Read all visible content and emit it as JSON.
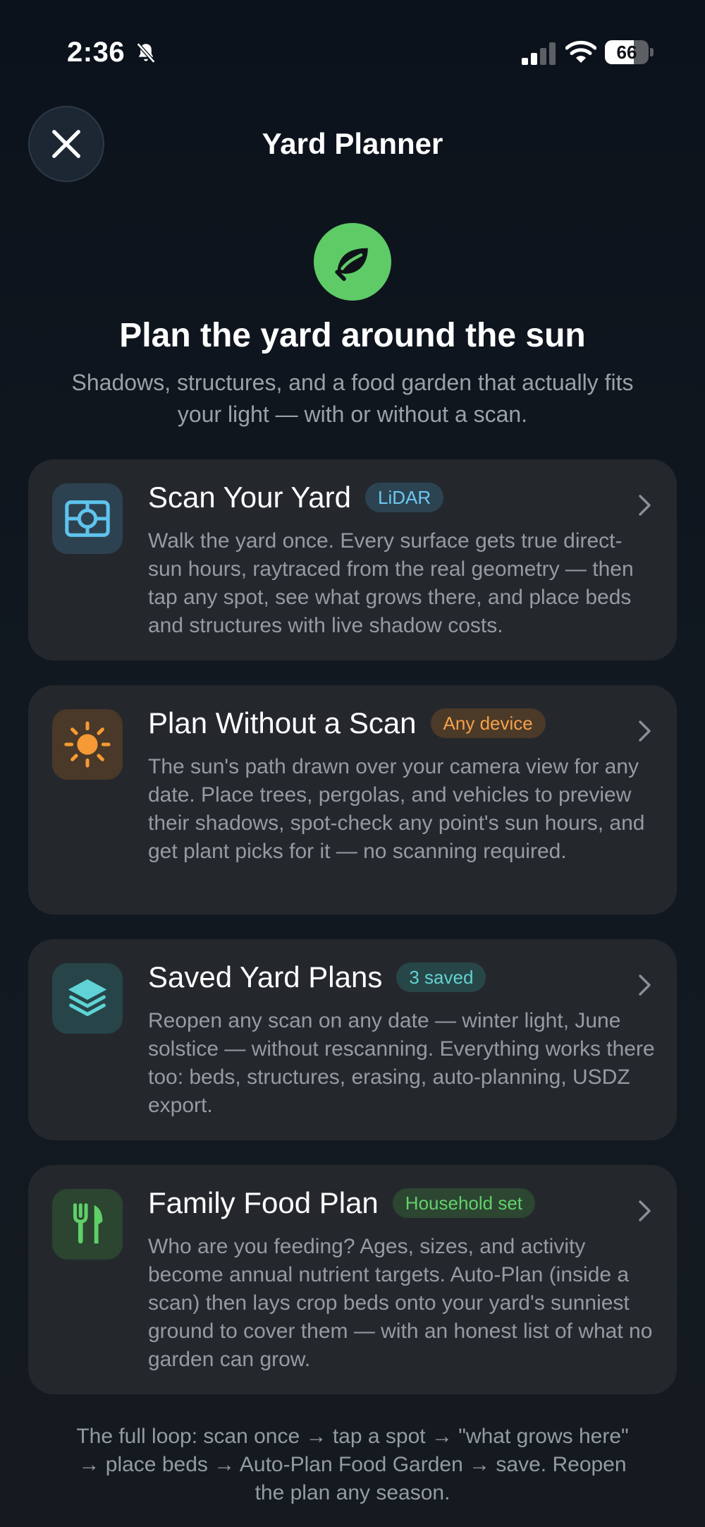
{
  "status": {
    "time": "2:36",
    "battery": "66",
    "battery_level": 0.66
  },
  "header": {
    "title": "Yard Planner"
  },
  "hero": {
    "title": "Plan the yard around the sun",
    "subtitle": "Shadows, structures, and a food garden that actually fits your light — with or without a scan."
  },
  "cards": [
    {
      "title": "Scan Your Yard",
      "badge": "LiDAR",
      "description": "Walk the yard once. Every surface gets true direct-sun hours, raytraced from the real geometry — then tap any spot, see what grows there, and place beds and structures with live shadow costs.",
      "icon": "scan-frame-icon",
      "colors": {
        "icon_bg": "#2d4250",
        "icon": "#5ec4ee",
        "badge_bg": "#2c4452",
        "badge_text": "#6cc9f0"
      }
    },
    {
      "title": "Plan Without a Scan",
      "badge": "Any device",
      "description": "The sun's path drawn over your camera view for any date. Place trees, pergolas, and vehicles to preview their shadows, spot-check any point's sun hours, and get plant picks for it — no scanning required.",
      "icon": "sun-icon",
      "colors": {
        "icon_bg": "#4a3828",
        "icon": "#f59a34",
        "badge_bg": "#4c3a28",
        "badge_text": "#f4a14a"
      }
    },
    {
      "title": "Saved Yard Plans",
      "badge": "3 saved",
      "description": "Reopen any scan on any date — winter light, June solstice — without rescanning. Everything works there too: beds, structures, erasing, auto-planning, USDZ export.",
      "icon": "layers-icon",
      "colors": {
        "icon_bg": "#274548",
        "icon": "#5fd3d6",
        "badge_bg": "#274647",
        "badge_text": "#63d1d2"
      }
    },
    {
      "title": "Family Food Plan",
      "badge": "Household set",
      "description": "Who are you feeding? Ages, sizes, and activity become annual nutrient targets. Auto-Plan (inside a scan) then lays crop beds onto your yard's sunniest ground to cover them — with an honest list of what no garden can grow.",
      "icon": "fork-knife-icon",
      "colors": {
        "icon_bg": "#2b4530",
        "icon": "#5fcf68",
        "badge_bg": "#2c4631",
        "badge_text": "#63d06b"
      }
    }
  ],
  "footer": "The full loop: scan once → tap a spot → \"what grows here\" → place beds → Auto-Plan Food Garden → save. Reopen the plan any season."
}
